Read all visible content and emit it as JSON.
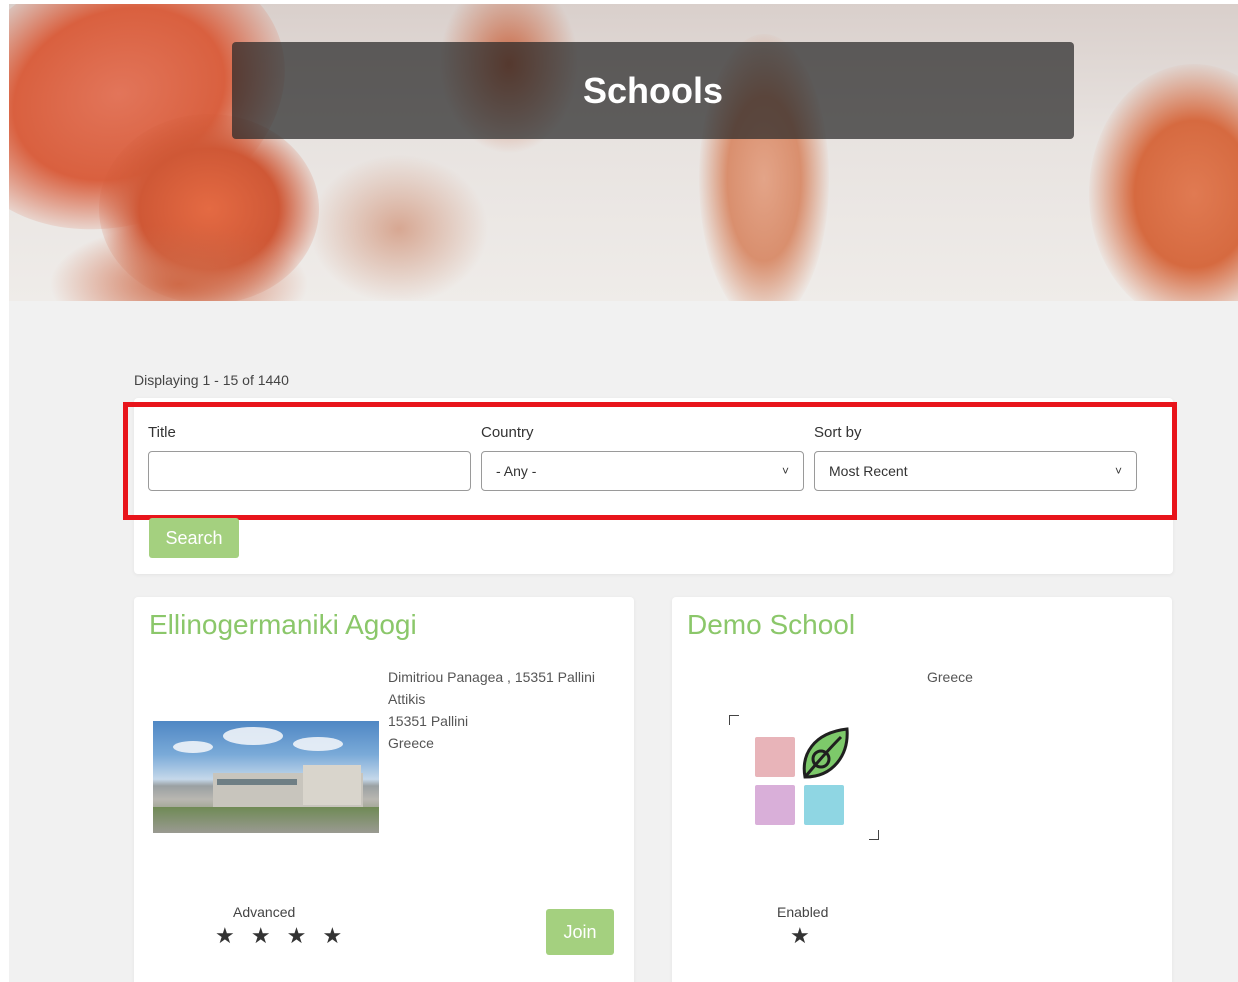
{
  "hero": {
    "title": "Schools"
  },
  "listing": {
    "display_count": "Displaying 1 - 15 of 1440"
  },
  "filters": {
    "title_label": "Title",
    "title_value": "",
    "country_label": "Country",
    "country_value": "- Any -",
    "sort_label": "Sort by",
    "sort_value": "Most Recent",
    "search_label": "Search"
  },
  "highlight_color": "#e8141b",
  "accent_color": "#a4d07f",
  "title_color": "#8bc76a",
  "cards": [
    {
      "title": "Ellinogermaniki Agogi",
      "address": [
        "Dimitriou Panagea , 15351 Pallini",
        "Attikis",
        "15351 Pallini",
        "Greece"
      ],
      "level": "Advanced",
      "stars": "★ ★ ★ ★",
      "rating": 4,
      "join_label": "Join"
    },
    {
      "title": "Demo School",
      "address": [
        "Greece"
      ],
      "level": "Enabled",
      "stars": "★",
      "rating": 1
    }
  ]
}
